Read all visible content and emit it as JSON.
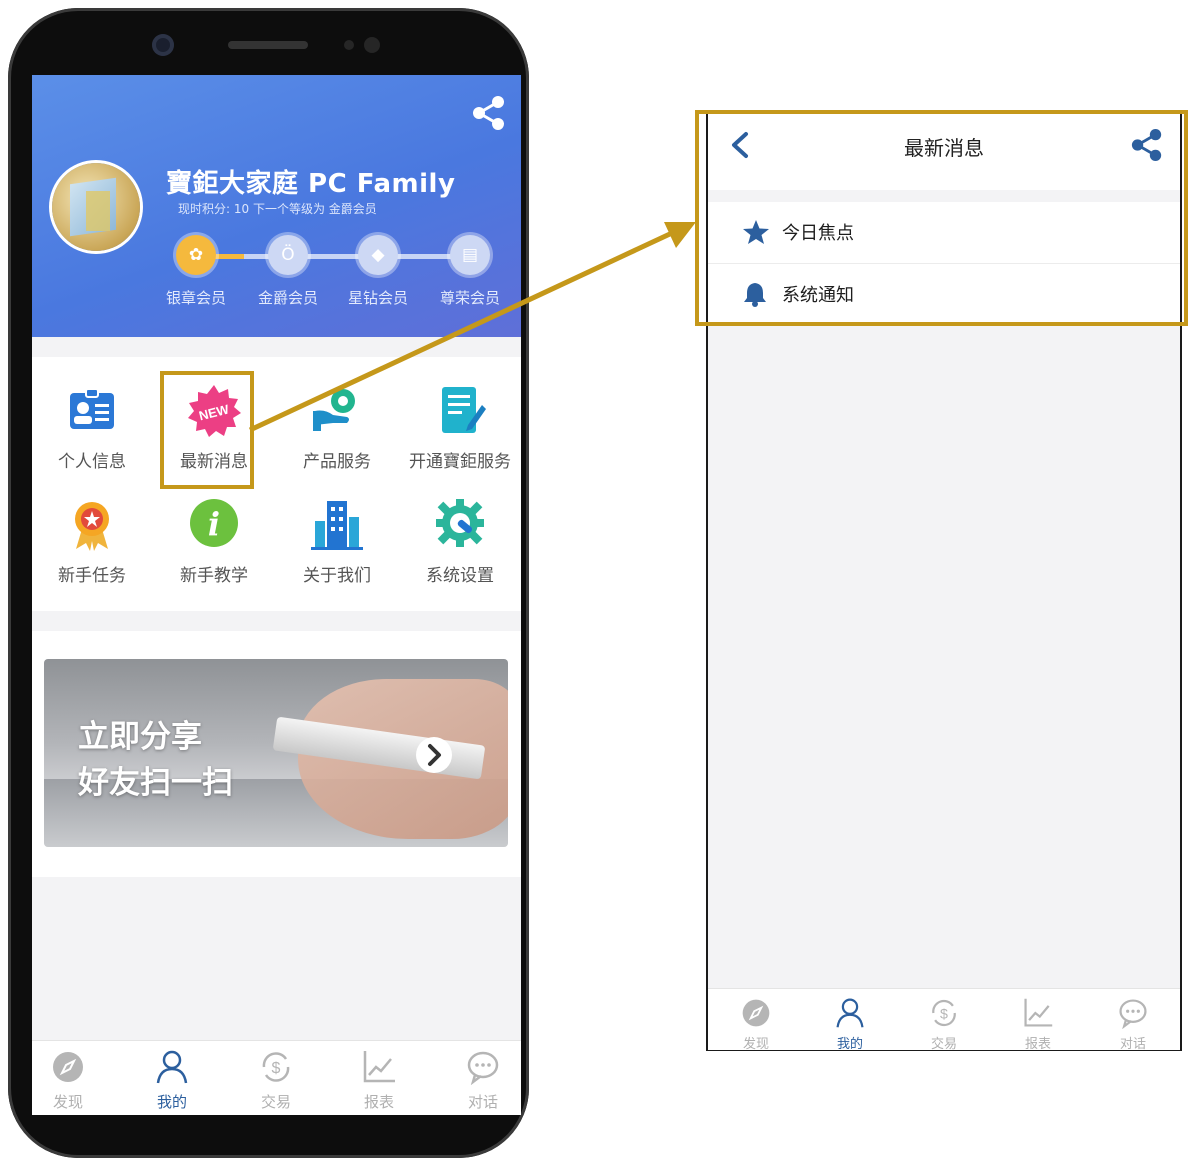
{
  "colors": {
    "accent": "#2c5f9e",
    "highlight": "#c5981a",
    "hero_blue": "#4a78df"
  },
  "profile": {
    "name": "寶鉅大家庭 PC Family",
    "points_line": "现时积分:  10    下一个等级为 金爵会员"
  },
  "levels": [
    {
      "label": "银章会员",
      "icon": "medal-icon"
    },
    {
      "label": "金爵会员",
      "icon": "money-bag-icon"
    },
    {
      "label": "星钻会员",
      "icon": "diamond-icon"
    },
    {
      "label": "尊荣会员",
      "icon": "crown-icon"
    }
  ],
  "menu": [
    {
      "label": "个人信息",
      "icon": "id-card-icon"
    },
    {
      "label": "最新消息",
      "icon": "new-badge-icon",
      "badge": "NEW"
    },
    {
      "label": "产品服务",
      "icon": "hand-gear-icon"
    },
    {
      "label": "开通寶鉅服务",
      "icon": "document-pen-icon"
    },
    {
      "label": "新手任务",
      "icon": "award-ribbon-icon"
    },
    {
      "label": "新手教学",
      "icon": "info-icon"
    },
    {
      "label": "关于我们",
      "icon": "building-icon"
    },
    {
      "label": "系统设置",
      "icon": "gear-wrench-icon"
    }
  ],
  "banner": {
    "line1": "立即分享",
    "line2": "好友扫一扫"
  },
  "tabs": [
    {
      "label": "发现",
      "icon": "compass-icon"
    },
    {
      "label": "我的",
      "icon": "person-icon"
    },
    {
      "label": "交易",
      "icon": "dollar-exchange-icon"
    },
    {
      "label": "报表",
      "icon": "line-chart-icon"
    },
    {
      "label": "对话",
      "icon": "chat-bubble-icon"
    }
  ],
  "messages_screen": {
    "title": "最新消息",
    "items": [
      {
        "label": "今日焦点",
        "icon": "star-icon"
      },
      {
        "label": "系统通知",
        "icon": "bell-icon"
      }
    ]
  }
}
